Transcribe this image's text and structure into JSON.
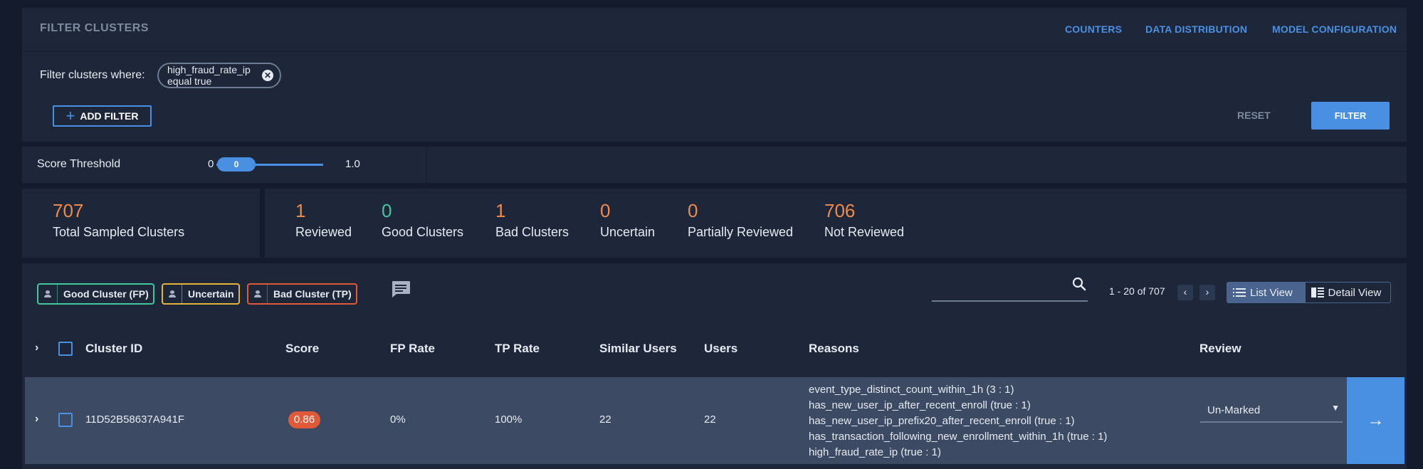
{
  "header": {
    "title": "FILTER CLUSTERS",
    "links": [
      "COUNTERS",
      "DATA DISTRIBUTION",
      "MODEL CONFIGURATION"
    ]
  },
  "filter": {
    "where_label": "Filter clusters where:",
    "chip_label": "high_fraud_rate_ip equal true",
    "add_filter_label": "ADD FILTER",
    "reset_label": "RESET",
    "filter_label": "FILTER"
  },
  "threshold": {
    "label": "Score Threshold",
    "min_label": "0",
    "value_label": "0",
    "max_label": "1.0",
    "value": 0
  },
  "stats": {
    "total": {
      "value": "707",
      "label": "Total Sampled Clusters"
    },
    "items": [
      {
        "value": "1",
        "label": "Reviewed"
      },
      {
        "value": "0",
        "label": "Good Clusters"
      },
      {
        "value": "1",
        "label": "Bad Clusters"
      },
      {
        "value": "0",
        "label": "Uncertain"
      },
      {
        "value": "0",
        "label": "Partially Reviewed"
      },
      {
        "value": "706",
        "label": "Not Reviewed"
      }
    ]
  },
  "legend": {
    "good": "Good Cluster (FP)",
    "uncertain": "Uncertain",
    "bad": "Bad Cluster (TP)"
  },
  "pagination": {
    "range": "1 - 20 of 707"
  },
  "views": {
    "list": "List View",
    "detail": "Detail View"
  },
  "table": {
    "columns": [
      "Cluster ID",
      "Score",
      "FP Rate",
      "TP Rate",
      "Similar Users",
      "Users",
      "Reasons",
      "Review"
    ],
    "rows": [
      {
        "cluster_id": "11D52B58637A941F",
        "score": "0.86",
        "fp_rate": "0%",
        "tp_rate": "100%",
        "similar_users": "22",
        "users": "22",
        "reasons": [
          "event_type_distinct_count_within_1h (3 : 1)",
          "has_new_user_ip_after_recent_enroll (true : 1)",
          "has_new_user_ip_prefix20_after_recent_enroll (true : 1)",
          "has_transaction_following_new_enrollment_within_1h (true : 1)",
          "high_fraud_rate_ip (true : 1)"
        ],
        "review": "Un-Marked"
      }
    ]
  },
  "colors": {
    "accent": "#4a90e2",
    "stat_orange": "#f08a4b",
    "stat_green": "#43c59e",
    "good_border": "#43c59e",
    "uncertain_border": "#e6b33a",
    "bad_border": "#e05a3a"
  }
}
